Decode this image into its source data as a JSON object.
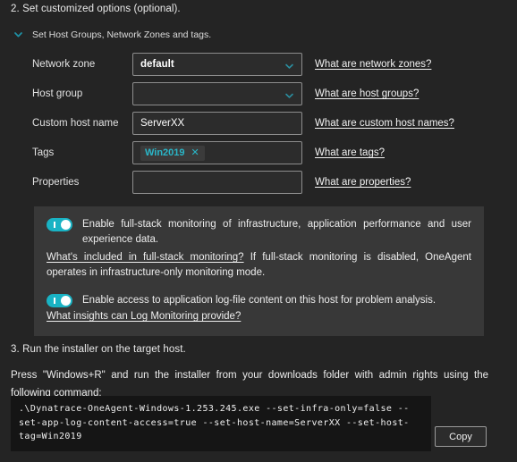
{
  "steps": {
    "step2_title": "2. Set customized options (optional).",
    "step3_title": "3. Run the installer on the target host."
  },
  "collapsible": {
    "label": "Set Host Groups, Network Zones and tags.",
    "icon": "chevron-down-icon",
    "expanded": true
  },
  "form": {
    "rows": [
      {
        "label": "Network zone",
        "type": "select",
        "value": "default",
        "help": "What are network zones?"
      },
      {
        "label": "Host group",
        "type": "select",
        "value": "",
        "help": "What are host groups?"
      },
      {
        "label": "Custom host name",
        "type": "text",
        "value": "ServerXX",
        "help": "What are custom host names?"
      },
      {
        "label": "Tags",
        "type": "tags",
        "value": "",
        "tag": "Win2019",
        "tag_remove": "✕",
        "help": "What are tags?"
      },
      {
        "label": "Properties",
        "type": "text",
        "value": "",
        "help": "What are properties?"
      }
    ]
  },
  "panel": {
    "fullstack": {
      "toggle_state": "on",
      "text": "Enable full-stack monitoring of infrastructure, application performance and user experience data.",
      "link": "What's included in full-stack monitoring?",
      "rest": " If full-stack monitoring is disabled, OneAgent operates in infrastructure-only monitoring mode."
    },
    "logs": {
      "toggle_state": "on",
      "text": "Enable access to application log-file content on this host for problem analysis.",
      "link": "What insights can Log Monitoring provide?"
    }
  },
  "install": {
    "instruction": "Press \"Windows+R\" and run the installer from your downloads folder with admin rights using the following command:",
    "command": ".\\Dynatrace-OneAgent-Windows-1.253.245.exe --set-infra-only=false --set-app-log-content-access=true --set-host-name=ServerXX --set-host-tag=Win2019",
    "copy_label": "Copy"
  },
  "colors": {
    "page_background": "#242424",
    "panel_background": "#383838",
    "accent": "#19b3c4",
    "chip_text": "#2ab6c8",
    "command_background": "#151515"
  }
}
